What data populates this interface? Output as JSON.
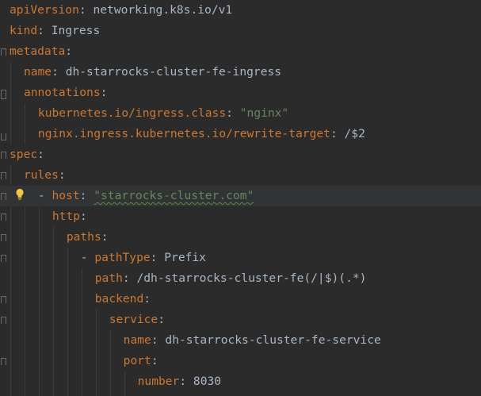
{
  "lines": [
    {
      "key": "apiVersion",
      "sep": ":",
      "value": " networking.k8s.io/v1"
    },
    {
      "key": "kind",
      "sep": ":",
      "value": " Ingress"
    },
    {
      "key": "metadata",
      "sep": ":",
      "value": ""
    },
    {
      "key": "name",
      "sep": ":",
      "value": " dh-starrocks-cluster-fe-ingress"
    },
    {
      "key": "annotations",
      "sep": ":",
      "value": ""
    },
    {
      "key": "kubernetes.io/ingress.class",
      "sep": ": ",
      "value": "\"nginx\""
    },
    {
      "key": "nginx.ingress.kubernetes.io/rewrite-target",
      "sep": ":",
      "value": " /$2"
    },
    {
      "key": "spec",
      "sep": ":",
      "value": ""
    },
    {
      "key": "rules",
      "sep": ":",
      "value": ""
    },
    {
      "dash": "- ",
      "key": "host",
      "sep": ": ",
      "value": "\"starrocks-cluster.com\""
    },
    {
      "key": "http",
      "sep": ":",
      "value": ""
    },
    {
      "key": "paths",
      "sep": ":",
      "value": ""
    },
    {
      "dash": "- ",
      "key": "pathType",
      "sep": ":",
      "value": " Prefix"
    },
    {
      "key": "path",
      "sep": ":",
      "value": " /dh-starrocks-cluster-fe(/|$)(.*)"
    },
    {
      "key": "backend",
      "sep": ":",
      "value": ""
    },
    {
      "key": "service",
      "sep": ":",
      "value": ""
    },
    {
      "key": "name",
      "sep": ":",
      "value": " dh-starrocks-cluster-fe-service"
    },
    {
      "key": "port",
      "sep": ":",
      "value": ""
    },
    {
      "key": "number",
      "sep": ":",
      "value": " 8030"
    }
  ],
  "colors": {
    "background": "#2b2b2b",
    "current_line": "#313335",
    "key": "#cc7832",
    "text": "#a9b7c6",
    "string": "#6a8759",
    "bulb": "#f2c744"
  },
  "icons": {
    "intention": "lightbulb-icon",
    "fold": "fold-marker-icon"
  }
}
